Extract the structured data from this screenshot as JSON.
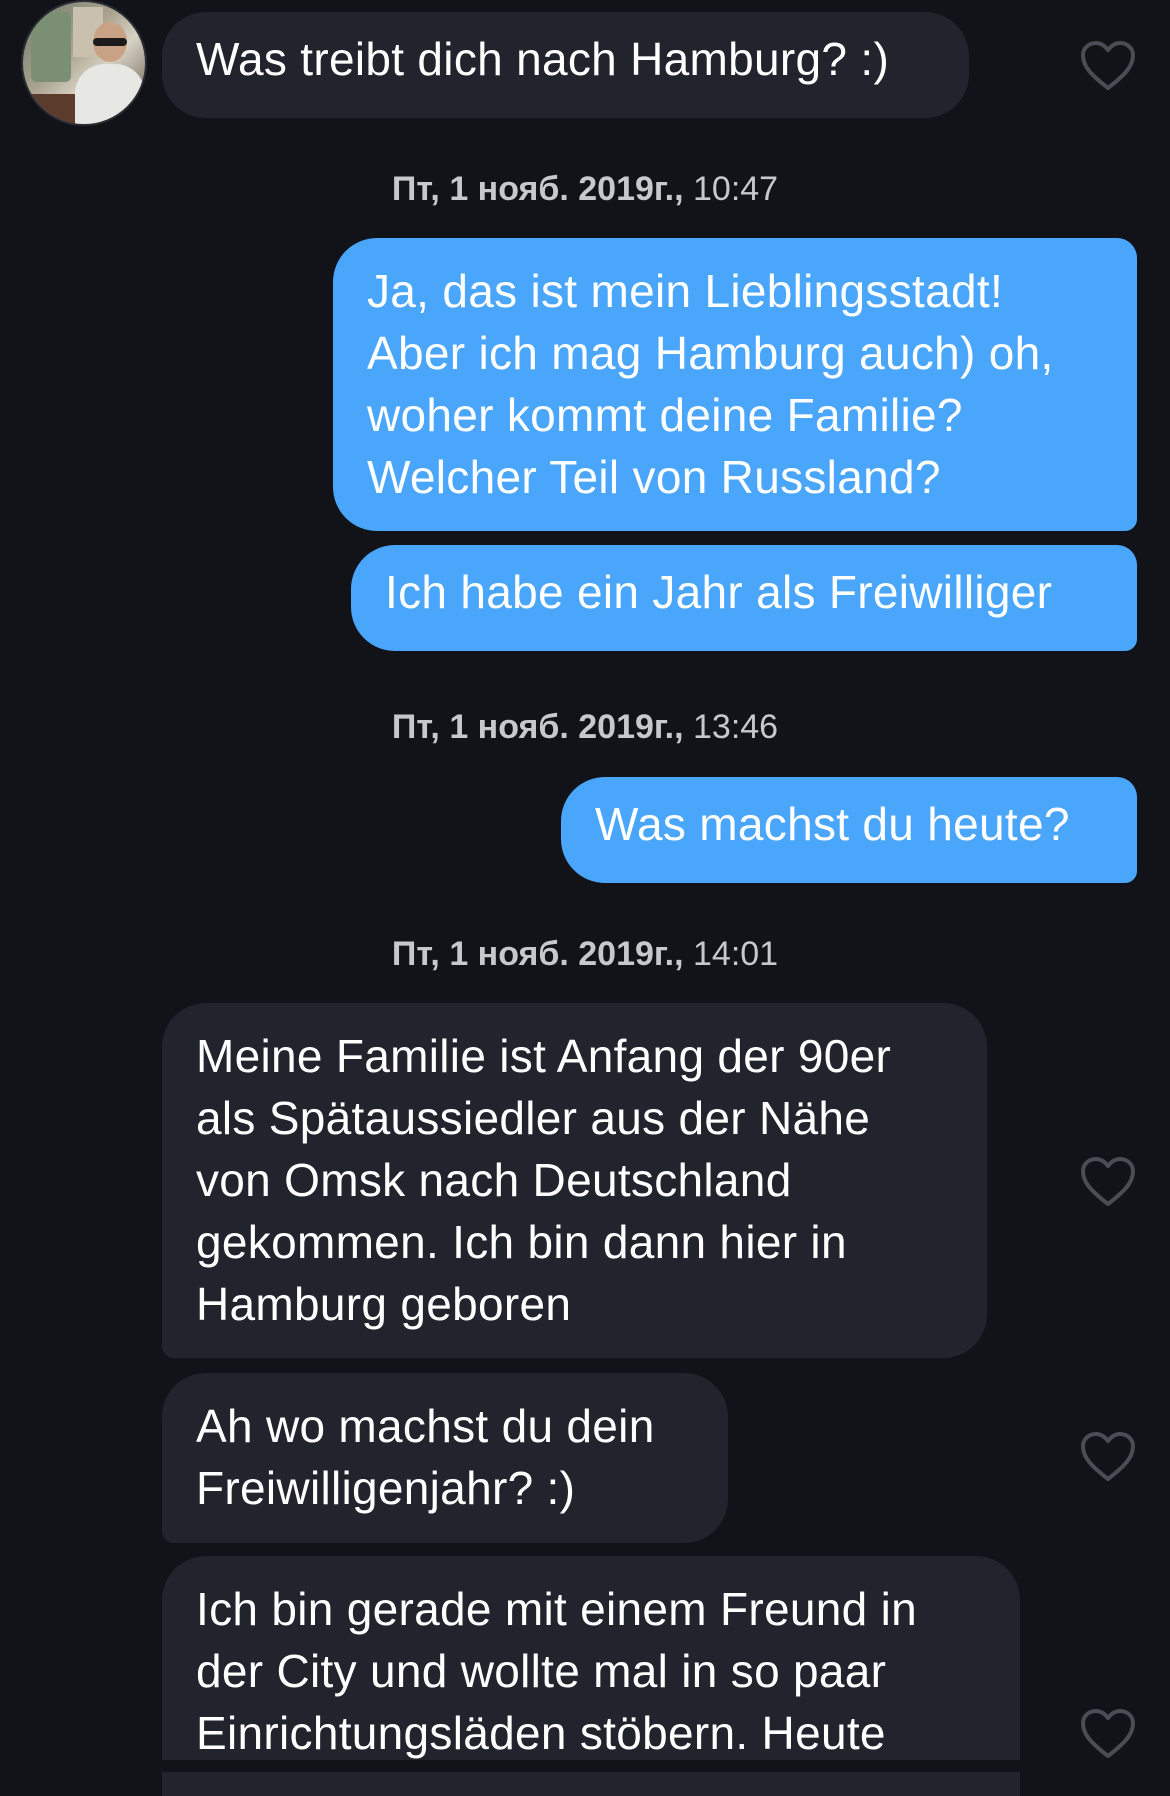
{
  "contact": {
    "avatar_icon": "profile-photo"
  },
  "messages": [
    {
      "id": "m1",
      "from": "them",
      "lines": [
        "Was treibt dich nach Hamburg? :)"
      ],
      "liked": false
    },
    {
      "id": "ts1",
      "type": "timestamp",
      "date": "Пт, 1 нояб. 2019г.,",
      "time": "10:47"
    },
    {
      "id": "m2",
      "from": "me",
      "lines": [
        "Ja, das ist mein Lieblingsstadt!",
        "Aber ich mag Hamburg auch) oh,",
        "woher kommt deine Familie?",
        "Welcher Teil von Russland?"
      ]
    },
    {
      "id": "m3",
      "from": "me",
      "lines": [
        "Ich habe ein Jahr als Freiwilliger"
      ]
    },
    {
      "id": "ts2",
      "type": "timestamp",
      "date": "Пт, 1 нояб. 2019г.,",
      "time": "13:46"
    },
    {
      "id": "m4",
      "from": "me",
      "lines": [
        "Was machst du heute?"
      ]
    },
    {
      "id": "ts3",
      "type": "timestamp",
      "date": "Пт, 1 нояб. 2019г.,",
      "time": "14:01"
    },
    {
      "id": "m5",
      "from": "them",
      "lines": [
        "Meine Familie ist Anfang der 90er",
        "als Spätaussiedler aus der Nähe",
        "von Omsk nach Deutschland",
        "gekommen. Ich bin dann hier in",
        "Hamburg geboren"
      ],
      "liked": false
    },
    {
      "id": "m6",
      "from": "them",
      "lines": [
        "Ah wo machst du dein",
        "Freiwilligenjahr? :)"
      ],
      "liked": false
    },
    {
      "id": "m7",
      "from": "them",
      "lines": [
        "Ich bin gerade mit einem Freund in",
        "der City und wollte mal in so paar",
        "Einrichtungsläden stöbern. Heute"
      ],
      "liked": false
    }
  ],
  "colors": {
    "background": "#111318",
    "incoming_bubble": "#21242c",
    "outgoing_bubble": "#4aa6fb",
    "timestamp_text": "#c6c8cc",
    "heart_outline": "#4a4d55"
  },
  "icons": {
    "like": "heart-outline-icon"
  }
}
